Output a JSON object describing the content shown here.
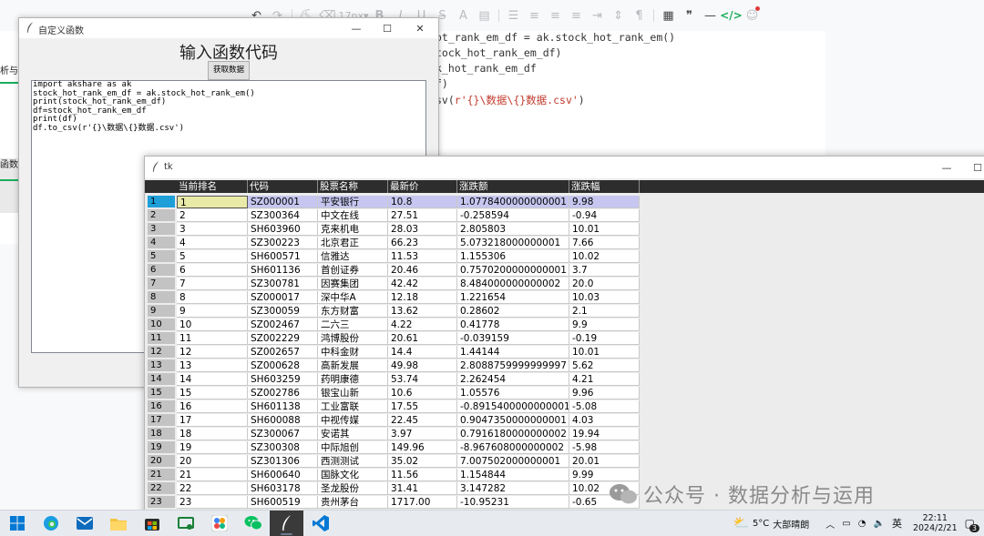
{
  "editor": {
    "font_size_label": "17px",
    "code_lines": [
      {
        "text": "ot_rank_em_df = ak.stock_hot_rank_em()",
        "str": ""
      },
      {
        "text": "tock_hot_rank_em_df)",
        "str": ""
      },
      {
        "text": "k_hot_rank_em_df",
        "str": ""
      },
      {
        "text": "f)",
        "str": ""
      },
      {
        "text": "sv(",
        "str": "r'{}\\数据\\{}数据.csv'",
        "tail": ")"
      }
    ],
    "left_tab_1": "析与",
    "left_tab_2": "函数样",
    "colors": {
      "accent_green": "#1aad5c",
      "error_red": "#e03a3a"
    }
  },
  "window1": {
    "title": "自定义函数",
    "heading": "输入函数代码",
    "button_label": "获取数据",
    "code": [
      "import akshare as ak",
      "stock_hot_rank_em_df = ak.stock_hot_rank_em()",
      "print(stock_hot_rank_em_df)",
      "df=stock_hot_rank_em_df",
      "print(df)",
      "df.to_csv(r'{}\\数据\\{}数据.csv')"
    ]
  },
  "window2": {
    "title": "tk",
    "columns": [
      "当前排名",
      "代码",
      "股票名称",
      "最新价",
      "涨跌额",
      "涨跌幅"
    ],
    "rows": [
      [
        "1",
        "1",
        "SZ000001",
        "平安银行",
        "10.8",
        "1.0778400000000001",
        "9.98"
      ],
      [
        "2",
        "2",
        "SZ300364",
        "中文在线",
        "27.51",
        "-0.258594",
        "-0.94"
      ],
      [
        "3",
        "3",
        "SH603960",
        "克来机电",
        "28.03",
        "2.805803",
        "10.01"
      ],
      [
        "4",
        "4",
        "SZ300223",
        "北京君正",
        "66.23",
        "5.073218000000001",
        "7.66"
      ],
      [
        "5",
        "5",
        "SH600571",
        "信雅达",
        "11.53",
        "1.155306",
        "10.02"
      ],
      [
        "6",
        "6",
        "SH601136",
        "首创证券",
        "20.46",
        "0.7570200000000001",
        "3.7"
      ],
      [
        "7",
        "7",
        "SZ300781",
        "因赛集团",
        "42.42",
        "8.484000000000002",
        "20.0"
      ],
      [
        "8",
        "8",
        "SZ000017",
        "深中华A",
        "12.18",
        "1.221654",
        "10.03"
      ],
      [
        "9",
        "9",
        "SZ300059",
        "东方财富",
        "13.62",
        "0.28602",
        "2.1"
      ],
      [
        "10",
        "10",
        "SZ002467",
        "二六三",
        "4.22",
        "0.41778",
        "9.9"
      ],
      [
        "11",
        "11",
        "SZ002229",
        "鸿博股份",
        "20.61",
        "-0.039159",
        "-0.19"
      ],
      [
        "12",
        "12",
        "SZ002657",
        "中科金财",
        "14.4",
        "1.44144",
        "10.01"
      ],
      [
        "13",
        "13",
        "SZ000628",
        "高新发展",
        "49.98",
        "2.8088759999999997",
        "5.62"
      ],
      [
        "14",
        "14",
        "SH603259",
        "药明康德",
        "53.74",
        "2.262454",
        "4.21"
      ],
      [
        "15",
        "15",
        "SZ002786",
        "银宝山新",
        "10.6",
        "1.05576",
        "9.96"
      ],
      [
        "16",
        "16",
        "SH601138",
        "工业富联",
        "17.55",
        "-0.8915400000000001",
        "-5.08"
      ],
      [
        "17",
        "17",
        "SH600088",
        "中视传媒",
        "22.45",
        "0.9047350000000001",
        "4.03"
      ],
      [
        "18",
        "18",
        "SZ300067",
        "安诺其",
        "3.97",
        "0.7916180000000002",
        "19.94"
      ],
      [
        "19",
        "19",
        "SZ300308",
        "中际旭创",
        "149.96",
        "-8.967608000000002",
        "-5.98"
      ],
      [
        "20",
        "20",
        "SZ301306",
        "西测测试",
        "35.02",
        "7.007502000000001",
        "20.01"
      ],
      [
        "21",
        "21",
        "SH600640",
        "国脉文化",
        "11.56",
        "1.154844",
        "9.99"
      ],
      [
        "22",
        "22",
        "SH603178",
        "圣龙股份",
        "31.41",
        "3.147282",
        "10.02"
      ],
      [
        "23",
        "23",
        "SH600519",
        "贵州茅台",
        "1717.00",
        "-10.95231",
        "-0.65"
      ]
    ]
  },
  "watermark": {
    "text": "公众号 · 数据分析与运用"
  },
  "taskbar": {
    "weather_temp": "5°C",
    "weather_desc": "大部晴朗",
    "ime": "英",
    "time": "22:11",
    "date": "2024/2/21",
    "notifications": "3"
  }
}
